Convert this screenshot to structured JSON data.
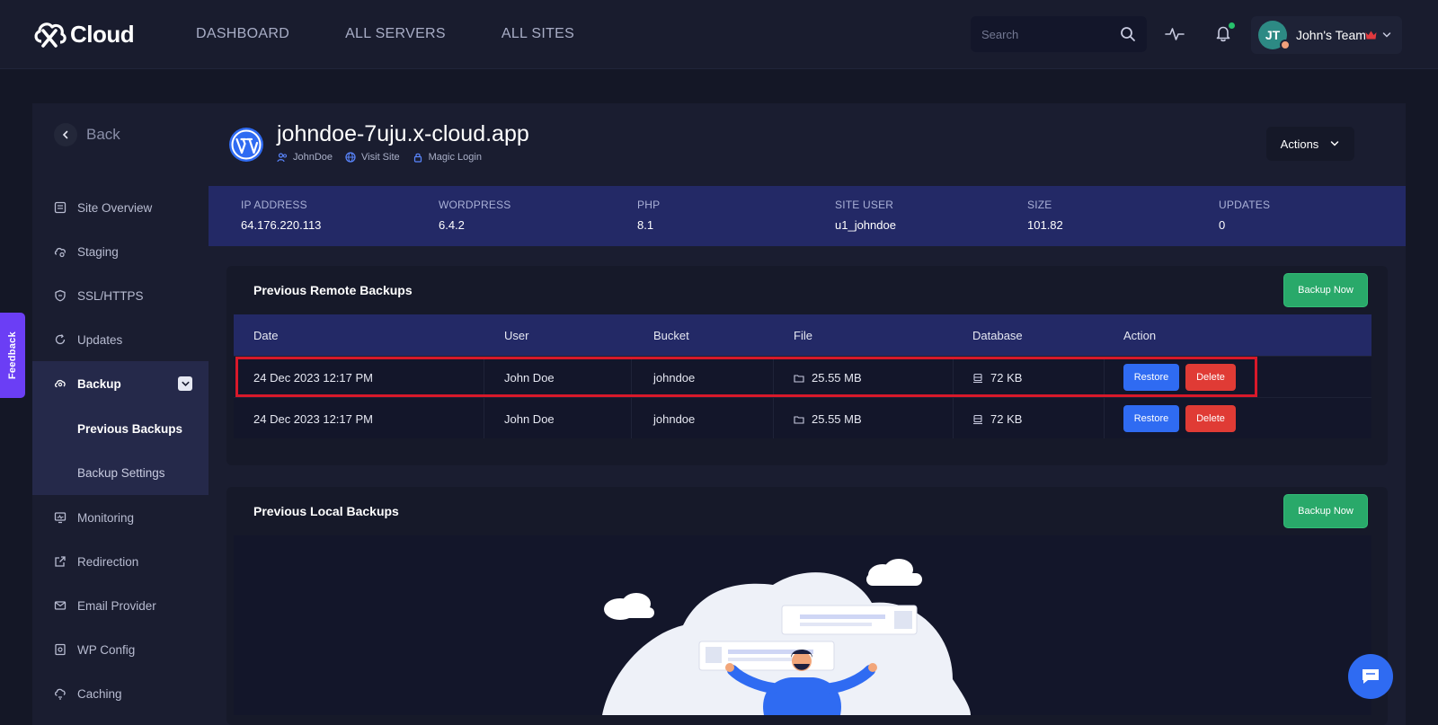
{
  "brand": {
    "name": "Cloud"
  },
  "nav": {
    "links": [
      "DASHBOARD",
      "ALL SERVERS",
      "ALL SITES"
    ]
  },
  "search": {
    "placeholder": "Search"
  },
  "user": {
    "initials": "JT",
    "team": "John's Team"
  },
  "sidebar": {
    "back_label": "Back",
    "items": [
      "Site Overview",
      "Staging",
      "SSL/HTTPS",
      "Updates",
      "Backup",
      "Monitoring",
      "Redirection",
      "Email Provider",
      "WP Config",
      "Caching"
    ],
    "backup_sub": [
      "Previous Backups",
      "Backup Settings"
    ]
  },
  "site": {
    "title": "johndoe-7uju.x-cloud.app",
    "owner": "JohnDoe",
    "visit": "Visit Site",
    "magic": "Magic Login",
    "actions_label": "Actions"
  },
  "stats": [
    {
      "label": "IP ADDRESS",
      "value": "64.176.220.113"
    },
    {
      "label": "WORDPRESS",
      "value": "6.4.2"
    },
    {
      "label": "PHP",
      "value": "8.1"
    },
    {
      "label": "SITE USER",
      "value": "u1_johndoe"
    },
    {
      "label": "SIZE",
      "value": "101.82"
    },
    {
      "label": "UPDATES",
      "value": "0"
    }
  ],
  "remote_backups": {
    "title": "Previous Remote Backups",
    "button": "Backup Now",
    "columns": [
      "Date",
      "User",
      "Bucket",
      "File",
      "Database",
      "Action"
    ],
    "rows": [
      {
        "date": "24 Dec 2023 12:17 PM",
        "user": "John Doe",
        "bucket": "johndoe",
        "file": "25.55 MB",
        "database": "72 KB"
      },
      {
        "date": "24 Dec 2023 12:17 PM",
        "user": "John Doe",
        "bucket": "johndoe",
        "file": "25.55 MB",
        "database": "72 KB"
      }
    ],
    "restore_label": "Restore",
    "delete_label": "Delete"
  },
  "local_backups": {
    "title": "Previous Local Backups",
    "button": "Backup Now"
  },
  "feedback": {
    "label": "Feedback"
  },
  "colors": {
    "accent": "#2f6bf2",
    "success": "#29a96a",
    "danger": "#e03b35",
    "highlight": "#d8192a",
    "stats_bg": "#232966"
  }
}
